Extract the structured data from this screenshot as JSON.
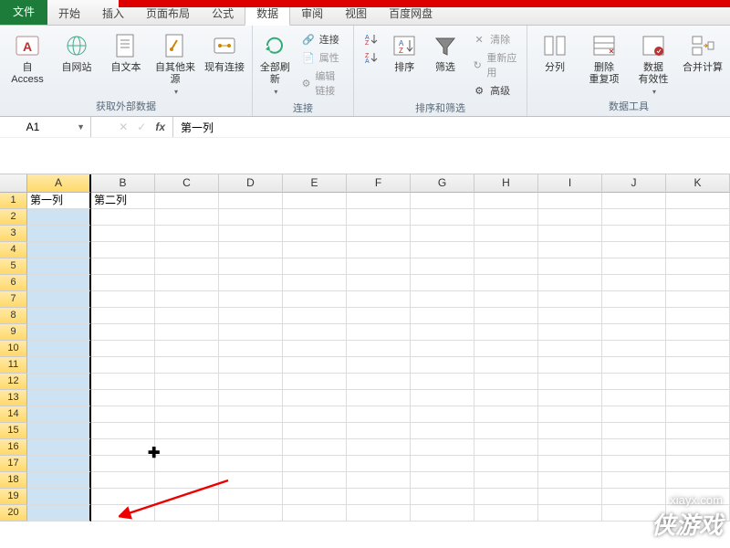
{
  "tabs": {
    "file": "文件",
    "items": [
      "开始",
      "插入",
      "页面布局",
      "公式",
      "数据",
      "审阅",
      "视图",
      "百度网盘"
    ],
    "active_index": 4
  },
  "ribbon": {
    "groups": [
      {
        "label": "获取外部数据",
        "big": [
          {
            "name": "from-access",
            "label": "自 Access"
          },
          {
            "name": "from-web",
            "label": "自网站"
          },
          {
            "name": "from-text",
            "label": "自文本"
          },
          {
            "name": "from-other",
            "label": "自其他来源"
          },
          {
            "name": "existing-conn",
            "label": "现有连接"
          }
        ]
      },
      {
        "label": "连接",
        "big": [
          {
            "name": "refresh-all",
            "label": "全部刷新"
          }
        ],
        "small": [
          {
            "name": "connections",
            "label": "连接"
          },
          {
            "name": "properties",
            "label": "属性",
            "dim": true
          },
          {
            "name": "edit-links",
            "label": "编辑链接",
            "dim": true
          }
        ]
      },
      {
        "label": "排序和筛选",
        "big": [
          {
            "name": "sort-az",
            "label": ""
          },
          {
            "name": "sort-za",
            "label": ""
          },
          {
            "name": "sort",
            "label": "排序"
          },
          {
            "name": "filter",
            "label": "筛选"
          }
        ],
        "small": [
          {
            "name": "clear",
            "label": "清除",
            "dim": true
          },
          {
            "name": "reapply",
            "label": "重新应用",
            "dim": true
          },
          {
            "name": "advanced",
            "label": "高级"
          }
        ]
      },
      {
        "label": "数据工具",
        "big": [
          {
            "name": "text-to-cols",
            "label": "分列"
          },
          {
            "name": "remove-dup",
            "label": "删除\n重复项"
          },
          {
            "name": "data-validation",
            "label": "数据\n有效性"
          },
          {
            "name": "consolidate",
            "label": "合并计算"
          }
        ]
      }
    ]
  },
  "namebox": {
    "value": "A1"
  },
  "formula": {
    "value": "第一列"
  },
  "columns": [
    "A",
    "B",
    "C",
    "D",
    "E",
    "F",
    "G",
    "H",
    "I",
    "J",
    "K"
  ],
  "selected_col_index": 0,
  "row_count": 20,
  "cells": {
    "A1": "第一列",
    "B1": "第二列"
  },
  "watermark": {
    "url": "xiayx.com",
    "brand": "侠游戏"
  }
}
